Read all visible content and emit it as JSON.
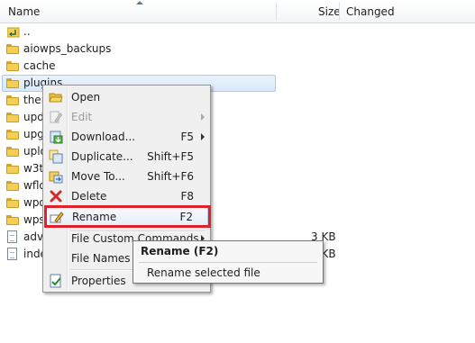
{
  "header": {
    "name": "Name",
    "size": "Size",
    "changed": "Changed"
  },
  "files": [
    {
      "name": "..",
      "type": "up"
    },
    {
      "name": "aiowps_backups",
      "type": "folder"
    },
    {
      "name": "cache",
      "type": "folder"
    },
    {
      "name": "plugins",
      "type": "folder",
      "selected": true
    },
    {
      "name": "ther",
      "type": "folder"
    },
    {
      "name": "upd",
      "type": "folder"
    },
    {
      "name": "upg",
      "type": "folder"
    },
    {
      "name": "uplo",
      "type": "folder"
    },
    {
      "name": "w3tc",
      "type": "folder"
    },
    {
      "name": "wflo",
      "type": "folder"
    },
    {
      "name": "wpo",
      "type": "folder"
    },
    {
      "name": "wps",
      "type": "folder"
    },
    {
      "name": "adva",
      "type": "file",
      "size": "3 KB"
    },
    {
      "name": "inde",
      "type": "file",
      "size": "1 KB"
    }
  ],
  "menu": {
    "items": [
      {
        "label": "Open",
        "shortcut": "",
        "icon": "open-folder-icon"
      },
      {
        "label": "Edit",
        "shortcut": "",
        "icon": "edit-icon",
        "disabled": true,
        "submenu": true
      },
      {
        "label": "Download...",
        "shortcut": "F5",
        "icon": "download-icon",
        "submenu": true
      },
      {
        "label": "Duplicate...",
        "shortcut": "Shift+F5",
        "icon": "duplicate-icon"
      },
      {
        "label": "Move To...",
        "shortcut": "Shift+F6",
        "icon": "move-icon"
      },
      {
        "label": "Delete",
        "shortcut": "F8",
        "icon": "delete-icon"
      },
      {
        "label": "Rename",
        "shortcut": "F2",
        "icon": "rename-icon",
        "highlighted": true
      },
      {
        "label": "File Custom Commands",
        "shortcut": "",
        "submenu": true
      },
      {
        "label": "File Names",
        "shortcut": "",
        "submenu": true
      },
      {
        "label": "Properties",
        "shortcut": "",
        "icon": "properties-icon"
      }
    ]
  },
  "tooltip": {
    "title": "Rename (F2)",
    "description": "Rename selected file"
  },
  "colors": {
    "highlight_box": "#e0202a",
    "selection": "#d8e9fb"
  }
}
